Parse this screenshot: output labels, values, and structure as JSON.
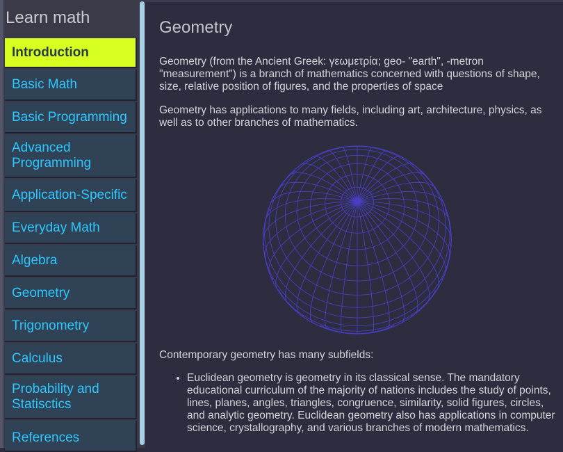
{
  "sidebar": {
    "title": "Learn math",
    "items": [
      {
        "label": "Introduction",
        "active": true
      },
      {
        "label": "Basic Math"
      },
      {
        "label": "Basic Programming"
      },
      {
        "label": "Advanced Programming"
      },
      {
        "label": "Application-Specific"
      },
      {
        "label": "Everyday Math"
      },
      {
        "label": "Algebra"
      },
      {
        "label": "Geometry"
      },
      {
        "label": "Trigonometry"
      },
      {
        "label": "Calculus"
      },
      {
        "label": "Probability and Statisctics"
      },
      {
        "label": "References"
      }
    ]
  },
  "main": {
    "title": "Geometry",
    "paragraphs": [
      "Geometry (from the Ancient Greek: γεωμετρία; geo- \"earth\", -metron \"measurement\") is a branch of mathematics concerned with questions of shape, size, relative position of figures, and the properties of space",
      "Geometry has applications to many fields, including art, architecture, physics, as well as to other branches of mathematics.",
      "Contemporary geometry has many subfields:"
    ],
    "subfields": [
      "Euclidean geometry is geometry in its classical sense. The mandatory educational curriculum of the majority of nations includes the study of points, lines, planes, angles, triangles, congruence, similarity, solid figures, circles, and analytic geometry. Euclidean geometry also has applications in computer science, crystallography, and various branches of modern mathematics."
    ]
  },
  "colors": {
    "nav_active_bg": "#d7ff1f",
    "nav_link": "#2ec8ff",
    "globe_line": "#4a3fc8"
  },
  "icons": {
    "globe": "wireframe-sphere-image"
  }
}
